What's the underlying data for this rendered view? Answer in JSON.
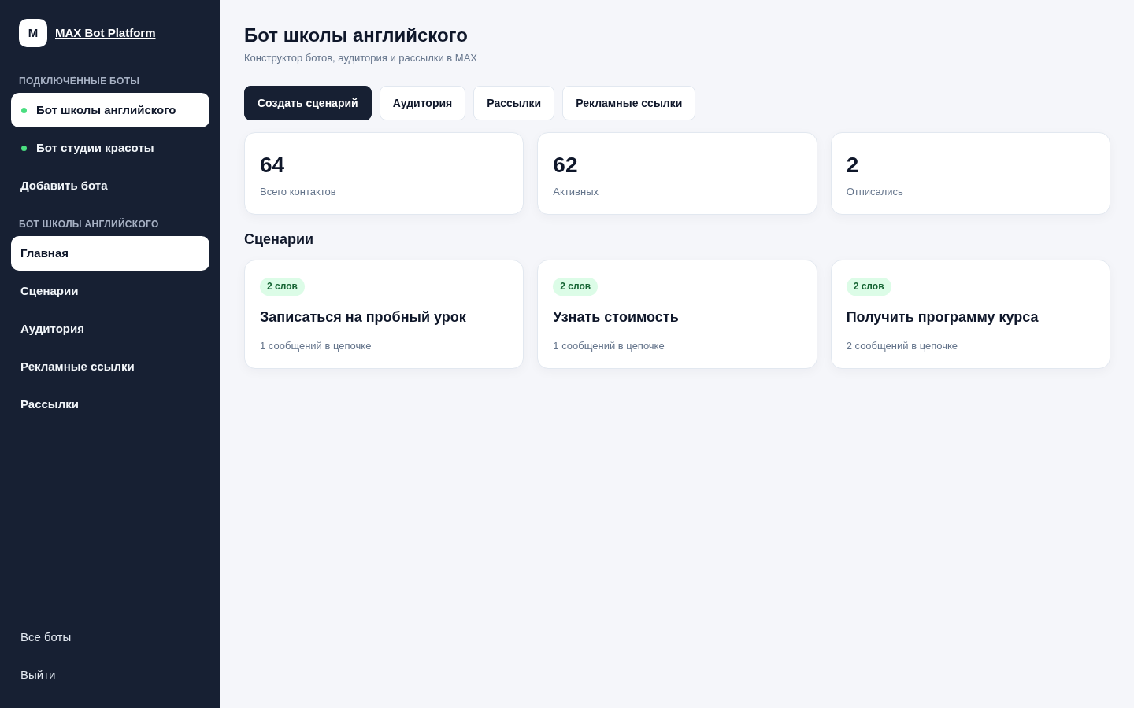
{
  "sidebar": {
    "logo": {
      "letter": "M",
      "title": "MAX Bot Platform"
    },
    "sections": [
      {
        "heading": "ПОДКЛЮЧЁННЫЕ БОТЫ",
        "items": [
          {
            "kind": "bot",
            "label": "Бот школы английского",
            "selected": true,
            "color": "#4ade80"
          },
          {
            "kind": "bot",
            "label": "Бот студии красоты",
            "selected": false,
            "color": "#4ade80"
          },
          {
            "kind": "nav",
            "label": "Добавить бота",
            "selected": false
          }
        ]
      },
      {
        "heading": "БОТ ШКОЛЫ АНГЛИЙСКОГО",
        "items": [
          {
            "kind": "nav",
            "label": "Главная",
            "selected": true
          },
          {
            "kind": "nav",
            "label": "Сценарии",
            "selected": false
          },
          {
            "kind": "nav",
            "label": "Аудитория",
            "selected": false
          },
          {
            "kind": "nav",
            "label": "Рекламные ссылки",
            "selected": false
          },
          {
            "kind": "nav",
            "label": "Рассылки",
            "selected": false
          }
        ]
      }
    ],
    "footer_links": [
      "Все боты",
      "Выйти"
    ]
  },
  "header": {
    "title": "Бот школы английского",
    "subtitle": "Конструктор ботов, аудитория и рассылки в MAX"
  },
  "actions": [
    {
      "kind": "primary",
      "label": "Создать сценарий"
    },
    {
      "kind": "outline",
      "label": "Аудитория"
    },
    {
      "kind": "outline",
      "label": "Рассылки"
    },
    {
      "kind": "outline",
      "label": "Рекламные ссылки"
    }
  ],
  "stats": [
    {
      "value": "64",
      "label": "Всего контактов"
    },
    {
      "value": "62",
      "label": "Активных"
    },
    {
      "value": "2",
      "label": "Отписались"
    }
  ],
  "scenarios": {
    "heading": "Сценарии",
    "items": [
      {
        "tag": "2 слов",
        "title": "Записаться на пробный урок",
        "subtitle": "1 сообщений в цепочке"
      },
      {
        "tag": "2 слов",
        "title": "Узнать стоимость",
        "subtitle": "1 сообщений в цепочке"
      },
      {
        "tag": "2 слов",
        "title": "Получить программу курса",
        "subtitle": "2 сообщений в цепочке"
      }
    ]
  }
}
